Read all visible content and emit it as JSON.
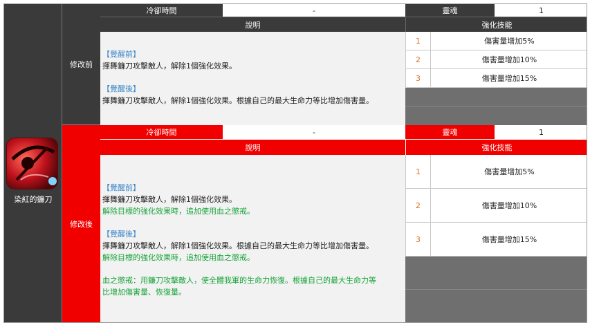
{
  "skill": {
    "name": "染紅的鐮刀"
  },
  "labels": {
    "before": "修改前",
    "after": "修改後"
  },
  "headers": {
    "cooldown": "冷卻時間",
    "soul": "靈魂",
    "description": "說明",
    "enhance": "強化技能"
  },
  "before": {
    "cooldown_value": "-",
    "soul_value": "1",
    "desc": {
      "pre_tag": "【覺醒前】",
      "pre_line1": "揮舞鐮刀攻擊敵人，解除1個強化效果。",
      "post_tag": "【覺醒後】",
      "post_line1": "揮舞鐮刀攻擊敵人，解除1個強化效果。根據自己的最大生命力等比增加傷害量。"
    },
    "enhance": [
      {
        "num": "1",
        "text": "傷害量增加5%"
      },
      {
        "num": "2",
        "text": "傷害量增加10%"
      },
      {
        "num": "3",
        "text": "傷害量增加15%"
      }
    ]
  },
  "after": {
    "cooldown_value": "-",
    "soul_value": "1",
    "desc": {
      "pre_tag": "【覺醒前】",
      "pre_line1": "揮舞鐮刀攻擊敵人，解除1個強化效果。",
      "pre_line2": "解除目標的強化效果時，追加使用血之懲戒。",
      "post_tag": "【覺醒後】",
      "post_line1": "揮舞鐮刀攻擊敵人，解除1個強化效果。根據自己的最大生命力等比增加傷害量。",
      "post_line2": "解除目標的強化效果時，追加使用血之懲戒。",
      "note_line1": "血之懲戒：用鐮刀攻擊敵人，使全體我軍的生命力恢復。根據自己的最大生命力等",
      "note_line2": "比增加傷害量、恢復量。"
    },
    "enhance": [
      {
        "num": "1",
        "text": "傷害量增加5%"
      },
      {
        "num": "2",
        "text": "傷害量增加10%"
      },
      {
        "num": "3",
        "text": "傷害量增加15%"
      }
    ]
  },
  "colors": {
    "dark": "#3a3a3a",
    "red": "#f10000",
    "blue_text": "#3a86c8",
    "green_text": "#17a43a",
    "number": "#e07020"
  },
  "icon": "red-scythe-skill-icon"
}
